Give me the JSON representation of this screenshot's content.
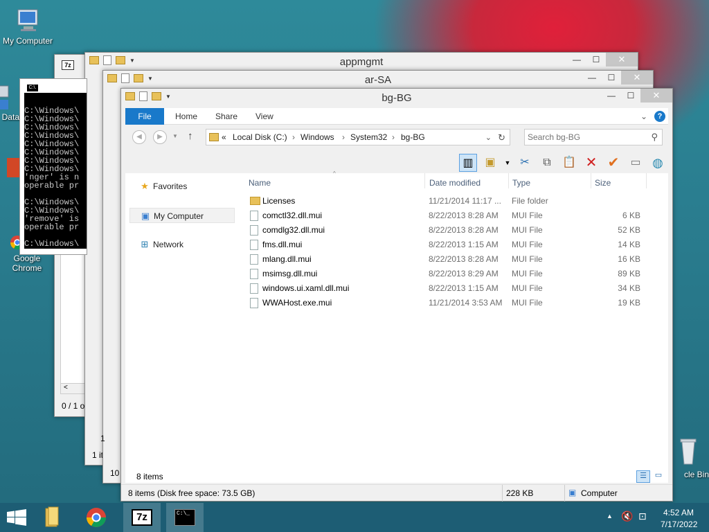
{
  "desktop": {
    "icons": [
      {
        "label": "My Computer",
        "icon": "computer-icon"
      },
      {
        "label": "Data",
        "icon": "data-icon"
      },
      {
        "label": "Google Chrome",
        "icon": "chrome-icon"
      },
      {
        "label": "cle Bin",
        "icon": "recycle-bin-icon"
      }
    ]
  },
  "back_windows": {
    "appmgmt_title": "appmgmt",
    "arsa_title": "ar-SA",
    "appmgmt_status": "1 it",
    "arsa_status": "10",
    "arsa_partial_1": "1",
    "sevenzip_status": "0 / 1 o",
    "sevenzip_scroll": "<",
    "sevenzip_label": "7z"
  },
  "cmd": {
    "title_icon": "C:\\.",
    "lines": [
      "C:\\Windows\\",
      "C:\\Windows\\",
      "C:\\Windows\\",
      "C:\\Windows\\",
      "C:\\Windows\\",
      "C:\\Windows\\",
      "C:\\Windows\\",
      "C:\\Windows\\",
      "'nger' is n",
      "operable pr",
      "",
      "C:\\Windows\\",
      "C:\\Windows\\",
      "'remove' is",
      "operable pr",
      "",
      "C:\\Windows\\"
    ]
  },
  "explorer": {
    "title": "bg-BG",
    "ribbon_tabs": [
      "File",
      "Home",
      "Share",
      "View"
    ],
    "address": {
      "prefix": "«",
      "crumbs": [
        "Local Disk (C:)",
        "Windows",
        "System32",
        "bg-BG"
      ],
      "search_placeholder": "Search bg-BG"
    },
    "nav_pane": [
      {
        "label": "Favorites",
        "icon": "star-icon"
      },
      {
        "label": "My Computer",
        "icon": "computer-icon"
      },
      {
        "label": "Network",
        "icon": "network-icon"
      }
    ],
    "columns": [
      "Name",
      "Date modified",
      "Type",
      "Size"
    ],
    "files": [
      {
        "name": "Licenses",
        "date": "11/21/2014 11:17 ...",
        "type": "File folder",
        "size": "",
        "kind": "folder"
      },
      {
        "name": "comctl32.dll.mui",
        "date": "8/22/2013 8:28 AM",
        "type": "MUI File",
        "size": "6 KB",
        "kind": "file"
      },
      {
        "name": "comdlg32.dll.mui",
        "date": "8/22/2013 8:28 AM",
        "type": "MUI File",
        "size": "52 KB",
        "kind": "file"
      },
      {
        "name": "fms.dll.mui",
        "date": "8/22/2013 1:15 AM",
        "type": "MUI File",
        "size": "14 KB",
        "kind": "file"
      },
      {
        "name": "mlang.dll.mui",
        "date": "8/22/2013 8:28 AM",
        "type": "MUI File",
        "size": "16 KB",
        "kind": "file"
      },
      {
        "name": "msimsg.dll.mui",
        "date": "8/22/2013 8:29 AM",
        "type": "MUI File",
        "size": "89 KB",
        "kind": "file"
      },
      {
        "name": "windows.ui.xaml.dll.mui",
        "date": "8/22/2013 1:15 AM",
        "type": "MUI File",
        "size": "34 KB",
        "kind": "file"
      },
      {
        "name": "WWAHost.exe.mui",
        "date": "11/21/2014 3:53 AM",
        "type": "MUI File",
        "size": "19 KB",
        "kind": "file"
      }
    ],
    "item_count": "8 items",
    "details_left": "8 items (Disk free space: 73.5 GB)",
    "details_size": "228 KB",
    "details_location": "Computer"
  },
  "taskbar": {
    "time": "4:52 AM",
    "date": "7/17/2022",
    "sevenzip_label": "7z",
    "cmd_label": "C:\\_"
  }
}
